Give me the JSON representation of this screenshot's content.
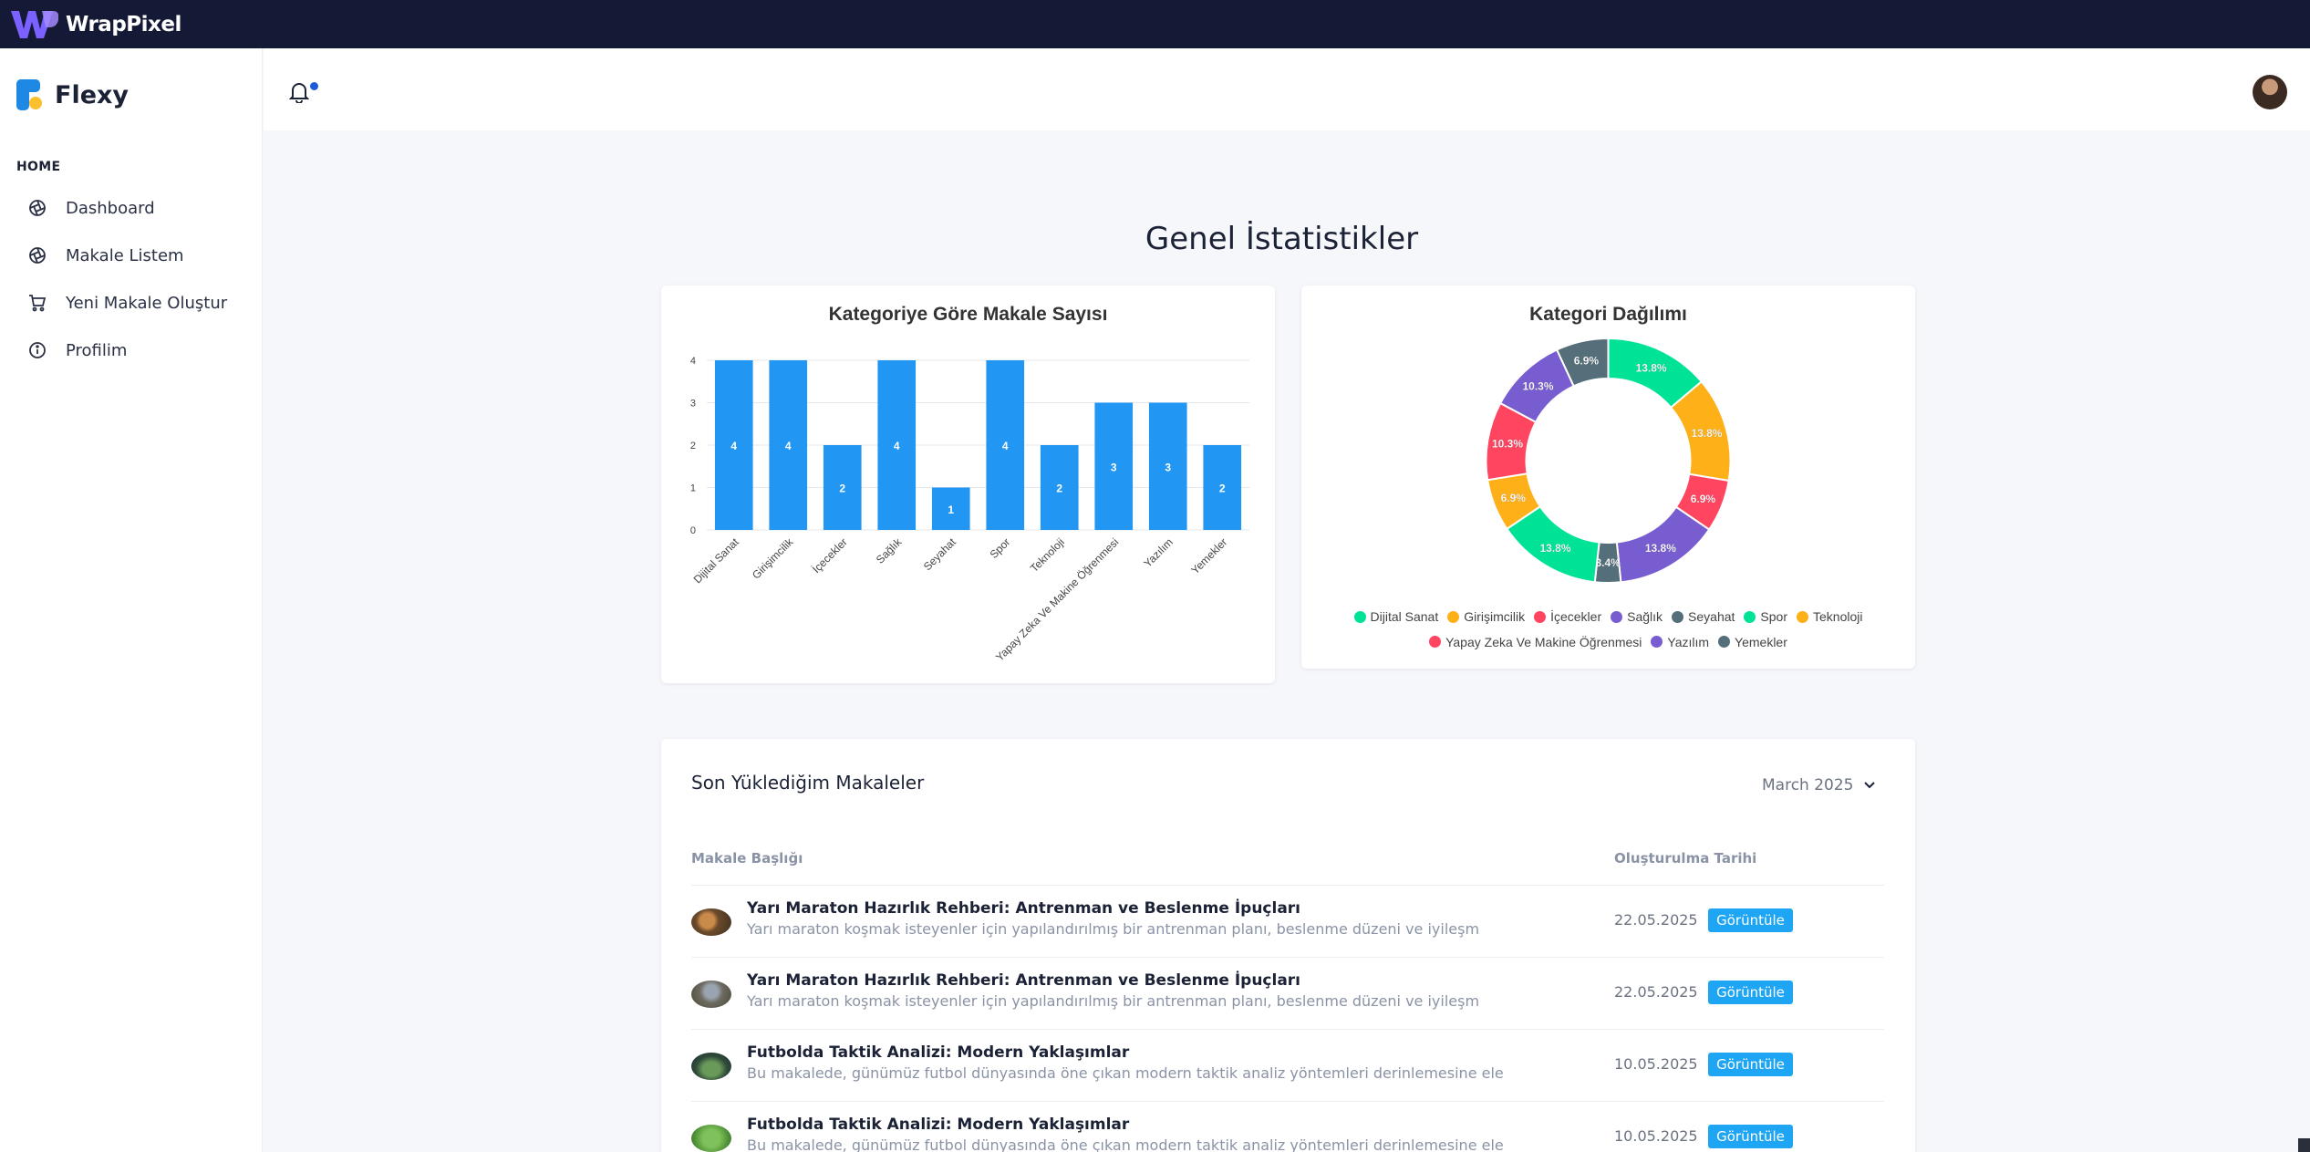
{
  "topbar": {
    "brand": "WrapPixel"
  },
  "sidebar": {
    "brand": "Flexy",
    "caption": "HOME",
    "items": [
      {
        "label": "Dashboard",
        "icon": "aperture-icon"
      },
      {
        "label": "Makale Listem",
        "icon": "aperture-icon"
      },
      {
        "label": "Yeni Makale Oluştur",
        "icon": "shopping-cart-icon"
      },
      {
        "label": "Profilim",
        "icon": "info-icon"
      }
    ]
  },
  "header": {
    "notification_icon": "bell-icon",
    "avatar": "user-avatar"
  },
  "page": {
    "title": "Genel İstatistikler"
  },
  "colors": {
    "bar": "#2196f3",
    "pie": [
      "#00e396",
      "#feb019",
      "#ff4560",
      "#775dd0",
      "#546e7a"
    ]
  },
  "chart_data": [
    {
      "type": "bar",
      "title": "Kategoriye Göre Makale Sayısı",
      "categories": [
        "Dijital Sanat",
        "Girişimcilik",
        "İçecekler",
        "Sağlık",
        "Seyahat",
        "Spor",
        "Teknoloji",
        "Yapay Zeka Ve Makine Öğrenmesi",
        "Yazılım",
        "Yemekler"
      ],
      "values": [
        4,
        4,
        2,
        4,
        1,
        4,
        2,
        3,
        3,
        2
      ],
      "ylim": [
        0,
        4
      ],
      "yticks": [
        0,
        1,
        2,
        3,
        4
      ],
      "grid": true
    },
    {
      "type": "pie",
      "title": "Kategori Dağılımı",
      "categories": [
        "Dijital Sanat",
        "Girişimcilik",
        "İçecekler",
        "Sağlık",
        "Seyahat",
        "Spor",
        "Teknoloji",
        "Yapay Zeka Ve Makine Öğrenmesi",
        "Yazılım",
        "Yemekler"
      ],
      "values": [
        13.8,
        13.8,
        6.9,
        13.8,
        3.4,
        13.8,
        6.9,
        10.3,
        10.3,
        6.9
      ],
      "labels": [
        "13.8%",
        "13.8%",
        "6.9%",
        "13.8%",
        "3.4%",
        "13.8%",
        "6.9%",
        "10.3%",
        "10.3%",
        "6.9%"
      ],
      "legend_placement": "bottom"
    }
  ],
  "articles": {
    "title": "Son Yüklediğim Makaleler",
    "month": "March 2025",
    "columns": [
      "Makale Başlığı",
      "Oluşturulma Tarihi"
    ],
    "rows": [
      {
        "title": "Yarı Maraton Hazırlık Rehberi: Antrenman ve Beslenme İpuçları",
        "desc": "Yarı maraton koşmak isteyenler için yapılandırılmış bir antrenman planı, beslenme düzeni ve iyileşm",
        "date": "22.05.2025",
        "action": "Görüntüle"
      },
      {
        "title": "Yarı Maraton Hazırlık Rehberi: Antrenman ve Beslenme İpuçları",
        "desc": "Yarı maraton koşmak isteyenler için yapılandırılmış bir antrenman planı, beslenme düzeni ve iyileşm",
        "date": "22.05.2025",
        "action": "Görüntüle"
      },
      {
        "title": "Futbolda Taktik Analizi: Modern Yaklaşımlar",
        "desc": "Bu makalede, günümüz futbol dünyasında öne çıkan modern taktik analiz yöntemleri derinlemesine ele",
        "date": "10.05.2025",
        "action": "Görüntüle"
      },
      {
        "title": "Futbolda Taktik Analizi: Modern Yaklaşımlar",
        "desc": "Bu makalede, günümüz futbol dünyasında öne çıkan modern taktik analiz yöntemleri derinlemesine ele",
        "date": "10.05.2025",
        "action": "Görüntüle"
      }
    ]
  }
}
